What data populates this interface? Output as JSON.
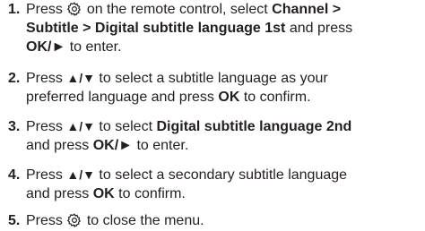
{
  "icons": {
    "menu": "gear-icon",
    "up_down": "up-down-arrow-icon",
    "play": "right-triangle-icon"
  },
  "steps": [
    {
      "number": "1.",
      "t1": "Press",
      "t2": "on the remote control, select",
      "b1": "Channel >",
      "b2": "Subtitle > Digital subtitle language 1st",
      "t3": "and press",
      "b3": "OK/►",
      "t4": "to enter."
    },
    {
      "number": "2.",
      "t1": "Press",
      "b1": "▲/▼",
      "t2": "to select a subtitle language as your",
      "t3": "preferred language and press",
      "b2": "OK",
      "t4": "to confirm."
    },
    {
      "number": "3.",
      "t1": "Press",
      "b1": "▲/▼",
      "t2": "to select",
      "b2": "Digital subtitle language 2nd",
      "t3": "and press",
      "b3": "OK/►",
      "t4": "to enter."
    },
    {
      "number": "4.",
      "t1": "Press",
      "b1": "▲/▼",
      "t2": "to select a secondary subtitle language",
      "t3": "and press",
      "b2": "OK",
      "t4": "to confirm."
    },
    {
      "number": "5.",
      "t1": "Press",
      "t2": "to close the menu."
    }
  ]
}
